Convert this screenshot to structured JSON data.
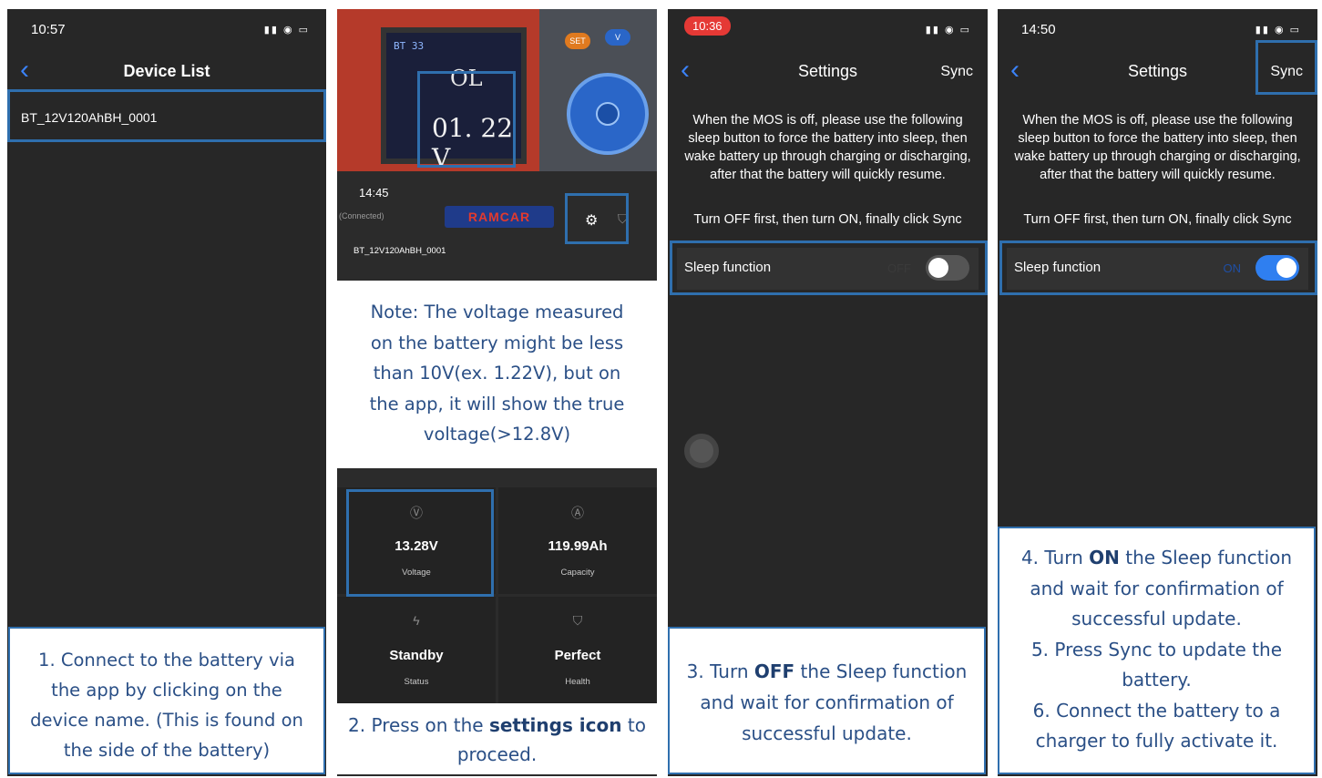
{
  "panel1": {
    "time": "10:57",
    "status_icons": "signal wifi battery",
    "nav_title": "Device List",
    "device_name": "BT_12V120AhBH_0001",
    "caption": "1. Connect to the battery via the app by clicking on the device name. (This is found on the side of the battery)"
  },
  "panel2": {
    "meter": {
      "top_text": "BT 33",
      "ol_text": "OL",
      "voltage_reading": "01. 22 V",
      "key_set": "SET",
      "key_v": "V"
    },
    "time": "14:45",
    "connected": "(Connected)",
    "brand": "RAMCAR",
    "device_name": "BT_12V120AhBH_0001",
    "note": "Note: The voltage measured on the battery might be less than 10V(ex. 1.22V), but on the app, it will show the true voltage(>12.8V)",
    "tiles": [
      {
        "icon": "V",
        "value": "13.28V",
        "label": "Voltage"
      },
      {
        "icon": "A",
        "value": "119.99Ah",
        "label": "Capacity"
      },
      {
        "icon": "bolt",
        "value": "Standby",
        "label": "Status"
      },
      {
        "icon": "shield",
        "value": "Perfect",
        "label": "Health"
      }
    ],
    "caption_pre": "2. Press on the ",
    "caption_bold": "settings icon",
    "caption_post": " to proceed."
  },
  "panel3": {
    "time": "10:36",
    "nav_title": "Settings",
    "sync": "Sync",
    "message": "When the MOS is off, please use the following sleep button to force the battery into sleep, then wake battery up through charging or discharging, after that the battery will quickly resume.",
    "instruction": "Turn OFF first, then turn ON, finally click Sync",
    "row_label": "Sleep function",
    "row_state": "OFF",
    "caption_pre": "3. Turn ",
    "caption_bold": "OFF",
    "caption_post": " the Sleep function and wait for confirmation of successful update."
  },
  "panel4": {
    "time": "14:50",
    "nav_title": "Settings",
    "sync": "Sync",
    "message": "When the MOS is off, please use the following sleep button to force the battery into sleep, then wake battery up through charging or discharging, after that the battery will quickly resume.",
    "instruction": "Turn OFF first, then turn ON, finally click Sync",
    "row_label": "Sleep function",
    "row_state": "ON",
    "caption_pre": "4. Turn ",
    "caption_bold": "ON",
    "caption_post": " the Sleep function and wait for confirmation of successful update.",
    "caption_line2": "5. Press Sync to update the battery.",
    "caption_line3": "6. Connect the battery to a charger to fully activate it."
  },
  "colors": {
    "highlight": "#2f6fae",
    "panel_bg": "#272727",
    "ios_blue": "#3b82f6",
    "toggle_on": "#2f7ff0"
  }
}
